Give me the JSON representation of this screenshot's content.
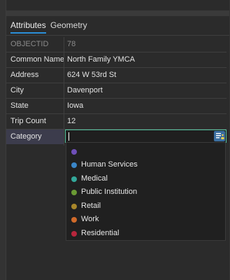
{
  "tabs": [
    {
      "label": "Attributes",
      "active": true
    },
    {
      "label": "Geometry",
      "active": false
    }
  ],
  "attributes": [
    {
      "label": "OBJECTID",
      "value": "78"
    },
    {
      "label": "Common Name",
      "value": "North Family YMCA"
    },
    {
      "label": "Address",
      "value": "624 W 53rd St"
    },
    {
      "label": "City",
      "value": "Davenport"
    },
    {
      "label": "State",
      "value": "Iowa"
    },
    {
      "label": "Trip Count",
      "value": "12"
    }
  ],
  "category": {
    "label": "Category",
    "value": "",
    "options": [
      {
        "label": "",
        "color": "#6f4fb8"
      },
      {
        "label": "Human Services",
        "color": "#3a86c8"
      },
      {
        "label": "Medical",
        "color": "#33a89a"
      },
      {
        "label": "Public Institution",
        "color": "#6a9a34"
      },
      {
        "label": "Retail",
        "color": "#a8862a"
      },
      {
        "label": "Work",
        "color": "#d06a2a"
      },
      {
        "label": "Residential",
        "color": "#b8263c"
      }
    ]
  },
  "colors": {
    "accent": "#2b8fd8",
    "focus_border": "#56c6a3"
  }
}
